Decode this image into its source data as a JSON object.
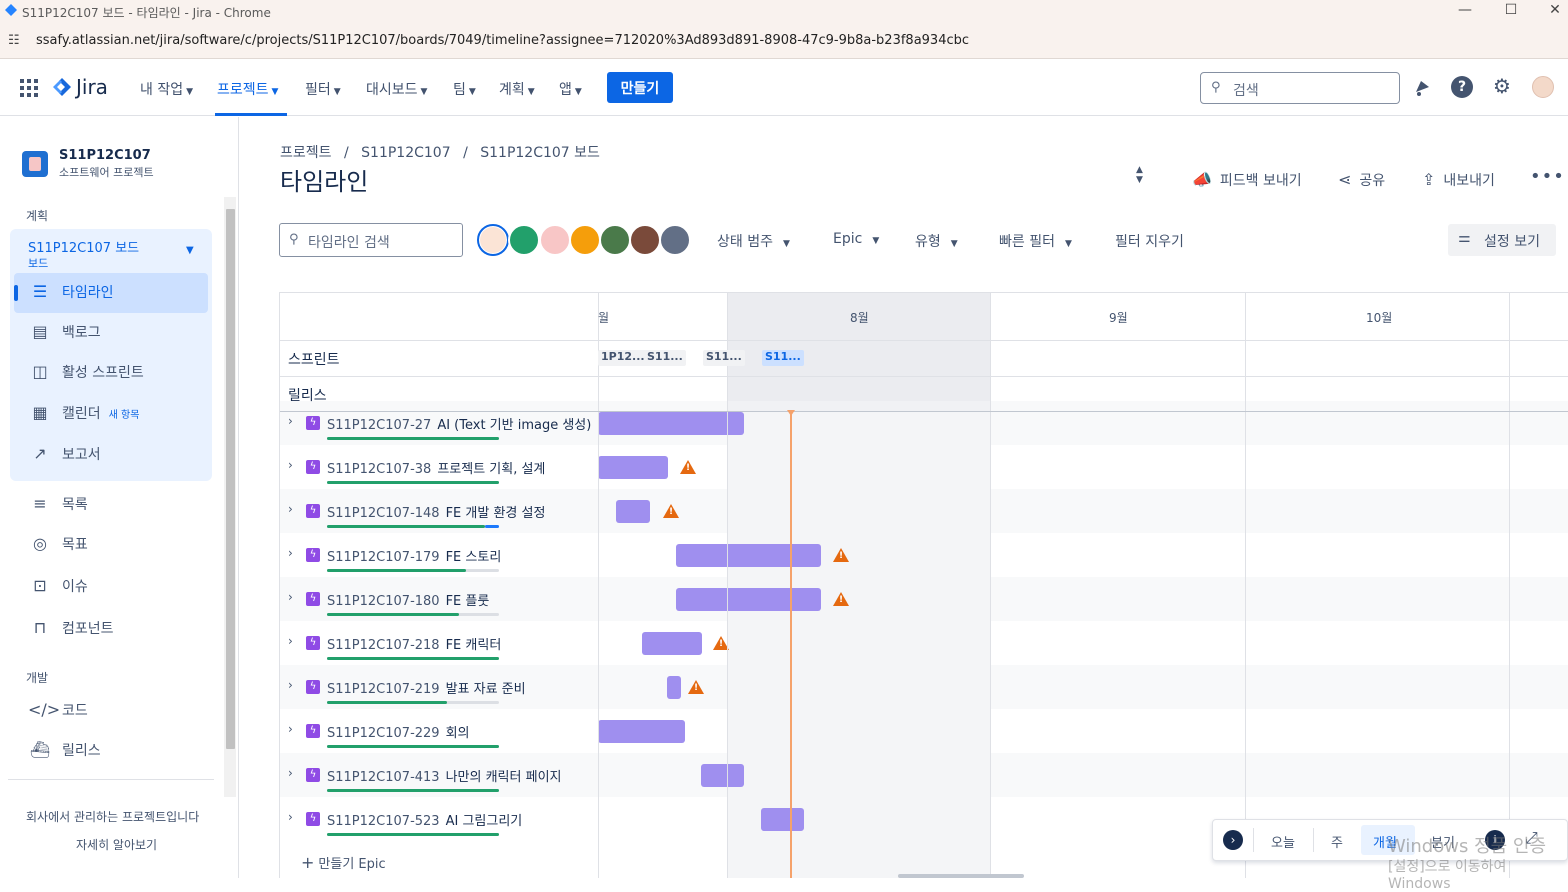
{
  "browser": {
    "window_title": "S11P12C107 보드 - 타임라인 - Jira - Chrome",
    "url": "ssafy.atlassian.net/jira/software/c/projects/S11P12C107/boards/7049/timeline?assignee=712020%3Ad893d891-8908-47c9-9b8a-b23f8a934cbc"
  },
  "topnav": {
    "product": "Jira",
    "items": [
      "내 작업",
      "프로젝트",
      "필터",
      "대시보드",
      "팀",
      "계획",
      "앱"
    ],
    "create_label": "만들기",
    "search_placeholder": "검색",
    "accent": "#0c66e4"
  },
  "sidebar": {
    "project_name": "S11P12C107",
    "project_type": "소프트웨어 프로젝트",
    "section_plan": "계획",
    "board_name": "S11P12C107 보드",
    "board_sub": "보드",
    "plan_items": [
      {
        "label": "타임라인",
        "icon": "timeline-icon"
      },
      {
        "label": "백로그",
        "icon": "backlog-icon"
      },
      {
        "label": "활성 스프린트",
        "icon": "board-icon"
      },
      {
        "label": "캘린더",
        "icon": "calendar-icon",
        "badge": "새 항목"
      },
      {
        "label": "보고서",
        "icon": "reports-icon"
      }
    ],
    "other_items": [
      {
        "label": "목록",
        "icon": "list-icon"
      },
      {
        "label": "목표",
        "icon": "goal-icon"
      },
      {
        "label": "이슈",
        "icon": "issues-icon"
      },
      {
        "label": "컴포넌트",
        "icon": "components-icon"
      }
    ],
    "section_dev": "개발",
    "dev_items": [
      {
        "label": "코드",
        "icon": "code-icon"
      },
      {
        "label": "릴리스",
        "icon": "release-icon"
      }
    ],
    "footer_text": "회사에서 관리하는 프로젝트입니다",
    "footer_link": "자세히 알아보기"
  },
  "page": {
    "breadcrumb": [
      "프로젝트",
      "S11P12C107",
      "S11P12C107 보드"
    ],
    "title": "타임라인",
    "actions": {
      "feedback": "피드백 보내기",
      "share": "공유",
      "export": "내보내기"
    },
    "timeline_search_placeholder": "타임라인 검색",
    "filters": [
      "상태 범주",
      "Epic",
      "유형",
      "빠른 필터"
    ],
    "clear_filters": "필터 지우기",
    "view_settings": "설정 보기"
  },
  "timeline": {
    "months": [
      "월",
      "8월",
      "9월",
      "10월"
    ],
    "row_sprints": "스프린트",
    "row_releases": "릴리스",
    "sprints": [
      {
        "label": "1P12...",
        "active": false
      },
      {
        "label": "S11...",
        "active": false
      },
      {
        "label": "S11...",
        "active": false
      },
      {
        "label": "S11...",
        "active": true
      }
    ],
    "epics": [
      {
        "key": "S11P12C107-27",
        "summary": "AI (Text 기반 image 생성)",
        "progress": 1.0,
        "progress_blue": 0,
        "warn": false
      },
      {
        "key": "S11P12C107-38",
        "summary": "프로젝트 기획, 설계",
        "progress": 1.0,
        "progress_blue": 0,
        "warn": true
      },
      {
        "key": "S11P12C107-148",
        "summary": "FE 개발 환경 설정",
        "progress": 0.92,
        "progress_blue": 0.08,
        "warn": true
      },
      {
        "key": "S11P12C107-179",
        "summary": "FE 스토리",
        "progress": 0.81,
        "progress_blue": 0,
        "warn": true
      },
      {
        "key": "S11P12C107-180",
        "summary": "FE 플룻",
        "progress": 0.77,
        "progress_blue": 0,
        "warn": true
      },
      {
        "key": "S11P12C107-218",
        "summary": "FE 캐릭터",
        "progress": 1.0,
        "progress_blue": 0,
        "warn": true
      },
      {
        "key": "S11P12C107-219",
        "summary": "발표 자료 준비",
        "progress": 0.7,
        "progress_blue": 0,
        "warn": true
      },
      {
        "key": "S11P12C107-229",
        "summary": "회의",
        "progress": 1.0,
        "progress_blue": 0,
        "warn": false
      },
      {
        "key": "S11P12C107-413",
        "summary": "나만의 캐릭터 페이지",
        "progress": 1.0,
        "progress_blue": 0,
        "warn": false
      },
      {
        "key": "S11P12C107-523",
        "summary": "AI 그림그리기",
        "progress": 1.0,
        "progress_blue": 0,
        "warn": false
      }
    ],
    "create_epic": "만들기 Epic",
    "zoom": {
      "today": "오늘",
      "options": [
        "주",
        "개월",
        "분기"
      ],
      "selected": "개월"
    },
    "bar_color": "#9f8fef",
    "warning_color": "#e56910"
  },
  "os_watermark": {
    "line1": "Windows 정품 인증",
    "line2": "[설정]으로 이동하여 Windows"
  }
}
